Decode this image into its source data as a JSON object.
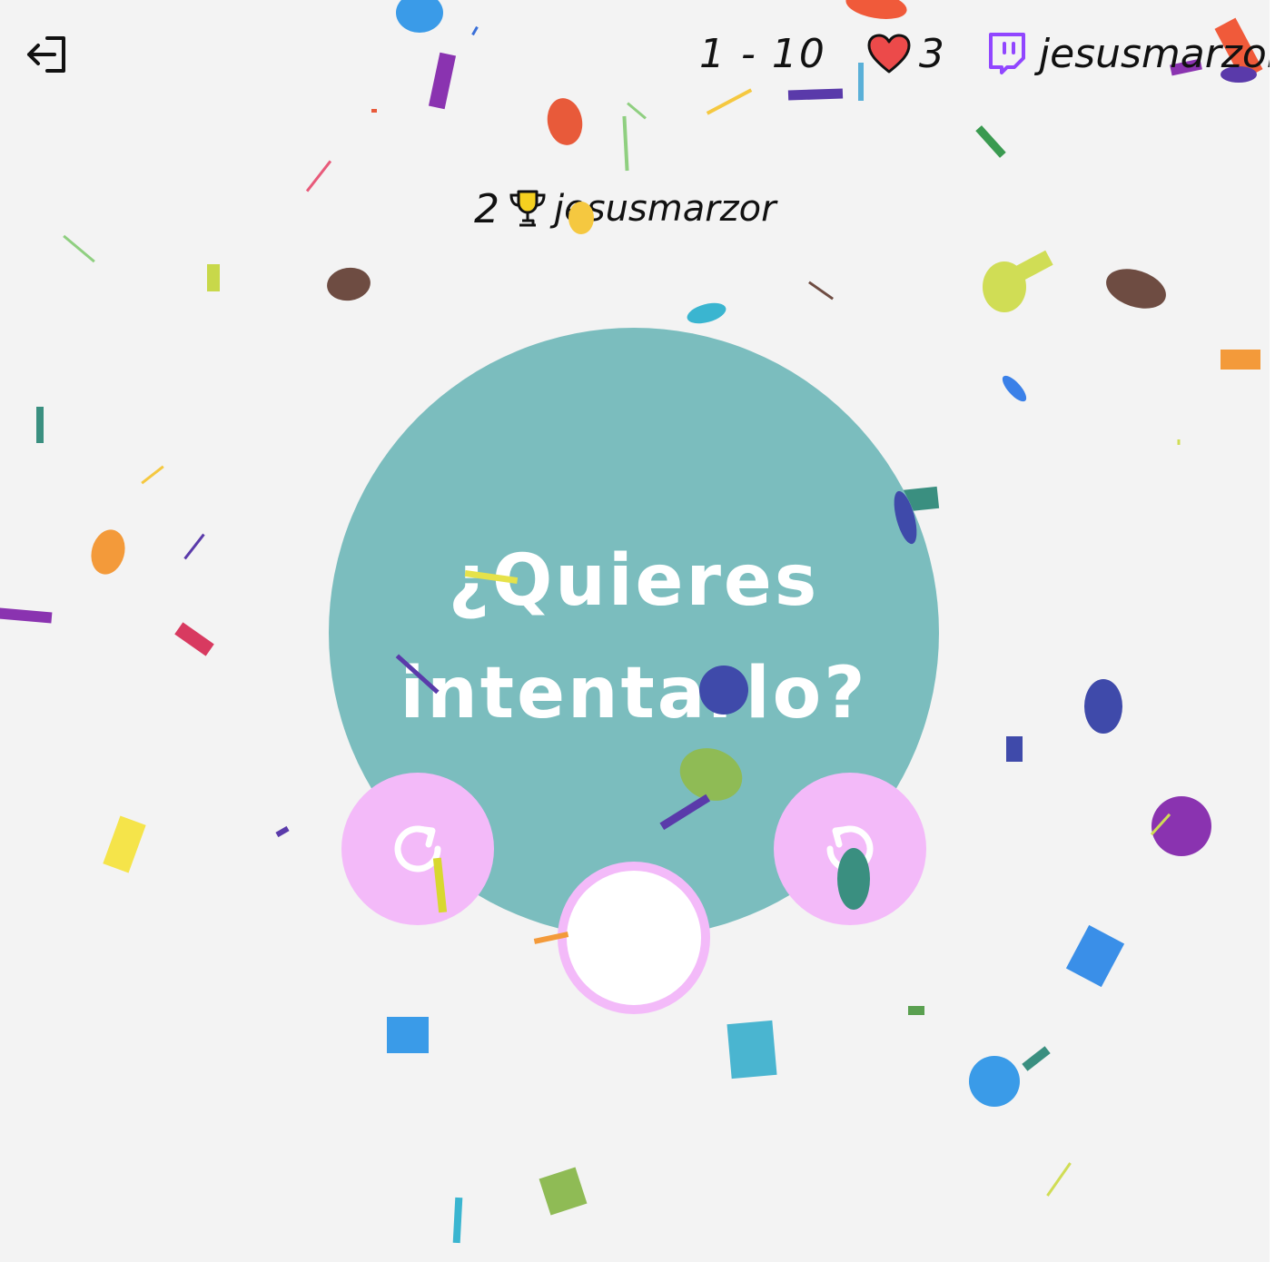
{
  "header": {
    "exit_icon": "exit-arrow-icon",
    "level_range": "1 - 10",
    "lives_icon": "heart-icon",
    "lives_count": "3",
    "twitch_icon": "twitch-icon",
    "username": "jesusmarzor"
  },
  "winner": {
    "rank": "2",
    "trophy_icon": "trophy-icon",
    "name": "jesusmarzor"
  },
  "prompt": {
    "line1": "¿Quieres",
    "line2": "intentarlo?"
  },
  "controls": {
    "left_button_icon": "rotate-clockwise-icon",
    "right_button_icon": "rotate-counterclockwise-icon",
    "center_button_icon": "ring-icon"
  },
  "colors": {
    "background": "#f3f3f3",
    "main_circle": "#7bbdbe",
    "button_pink": "#f3baf9",
    "heart_red": "#ec4a4a",
    "twitch_purple": "#9146ff",
    "trophy_gold": "#f5d020"
  }
}
